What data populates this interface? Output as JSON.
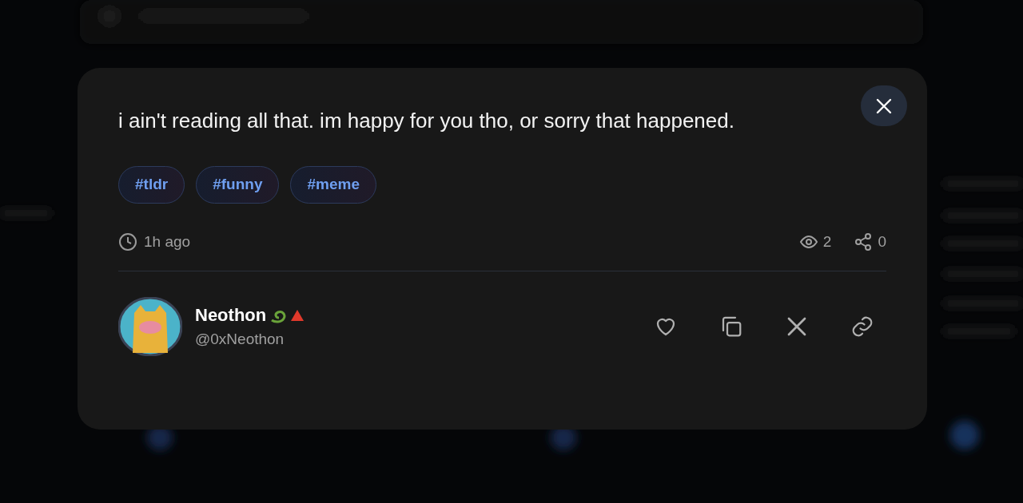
{
  "post": {
    "text": "i ain't reading all that. im happy for you tho, or sorry that happened.",
    "tags": [
      "#tldr",
      "#funny",
      "#meme"
    ],
    "time": "1h ago",
    "views": "2",
    "shares": "0"
  },
  "author": {
    "name": "Neothon",
    "handle": "@0xNeothon"
  },
  "actions": [
    {
      "kind": "like"
    },
    {
      "kind": "copy"
    },
    {
      "kind": "x"
    },
    {
      "kind": "link"
    }
  ]
}
